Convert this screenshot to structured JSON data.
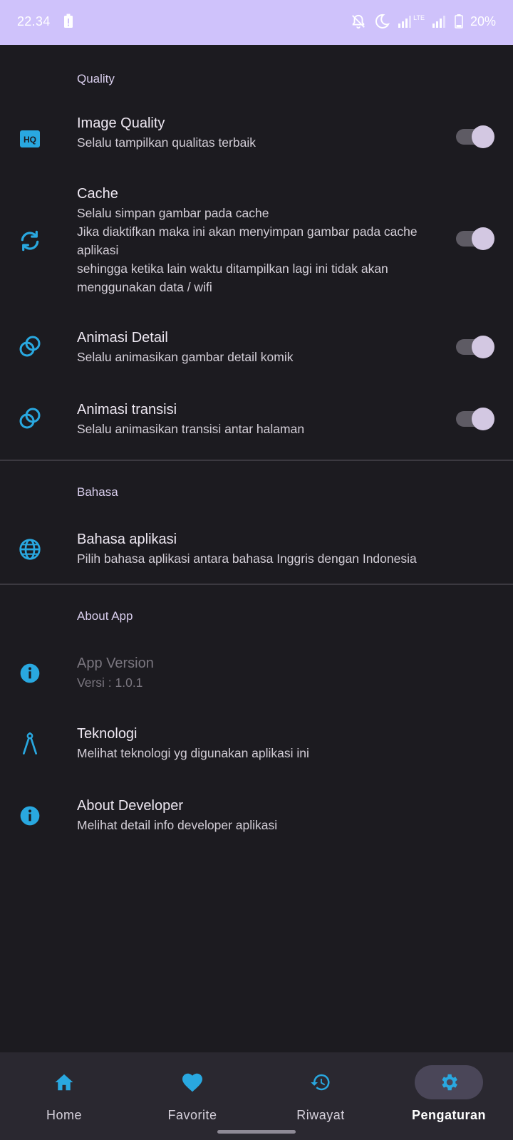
{
  "status_bar": {
    "time": "22.34",
    "battery_percent": "20%",
    "network_label": "LTE",
    "icons": [
      "alert-icon",
      "bell-off-icon",
      "moon-icon",
      "signal-icon",
      "signal-icon",
      "battery-icon"
    ]
  },
  "colors": {
    "accent": "#29a8e0",
    "status_bar": "#cfc2fb",
    "background": "#1c1b20",
    "nav_background": "#2a2830",
    "section_header": "#d8cdec"
  },
  "sections": {
    "quality": {
      "header": "Quality",
      "items": [
        {
          "icon": "hq-icon",
          "title": "Image Quality",
          "desc": "Selalu tampilkan qualitas terbaik",
          "toggle": true
        },
        {
          "icon": "sync-icon",
          "title": "Cache",
          "desc": "Selalu simpan gambar pada cache\nJika diaktifkan maka ini akan menyimpan gambar pada cache aplikasi\nsehingga ketika lain waktu ditampilkan lagi ini tidak akan menggunakan data / wifi",
          "toggle": true
        },
        {
          "icon": "rings-icon",
          "title": "Animasi Detail",
          "desc": "Selalu animasikan gambar detail komik",
          "toggle": true
        },
        {
          "icon": "rings-icon",
          "title": "Animasi transisi",
          "desc": "Selalu animasikan transisi antar halaman",
          "toggle": true
        }
      ]
    },
    "language": {
      "header": "Bahasa",
      "items": [
        {
          "icon": "globe-icon",
          "title": "Bahasa aplikasi",
          "desc": "Pilih bahasa aplikasi antara bahasa Inggris dengan Indonesia"
        }
      ]
    },
    "about": {
      "header": "About App",
      "items": [
        {
          "icon": "info-icon",
          "title": "App Version",
          "desc": "Versi : 1.0.1",
          "disabled": true
        },
        {
          "icon": "compass-tool-icon",
          "title": "Teknologi",
          "desc": "Melihat teknologi yg digunakan aplikasi ini"
        },
        {
          "icon": "info-icon",
          "title": "About Developer",
          "desc": "Melihat detail info developer aplikasi"
        }
      ]
    }
  },
  "bottom_nav": {
    "items": [
      {
        "icon": "home-icon",
        "label": "Home",
        "active": false
      },
      {
        "icon": "heart-icon",
        "label": "Favorite",
        "active": false
      },
      {
        "icon": "history-icon",
        "label": "Riwayat",
        "active": false
      },
      {
        "icon": "gear-icon",
        "label": "Pengaturan",
        "active": true
      }
    ]
  }
}
